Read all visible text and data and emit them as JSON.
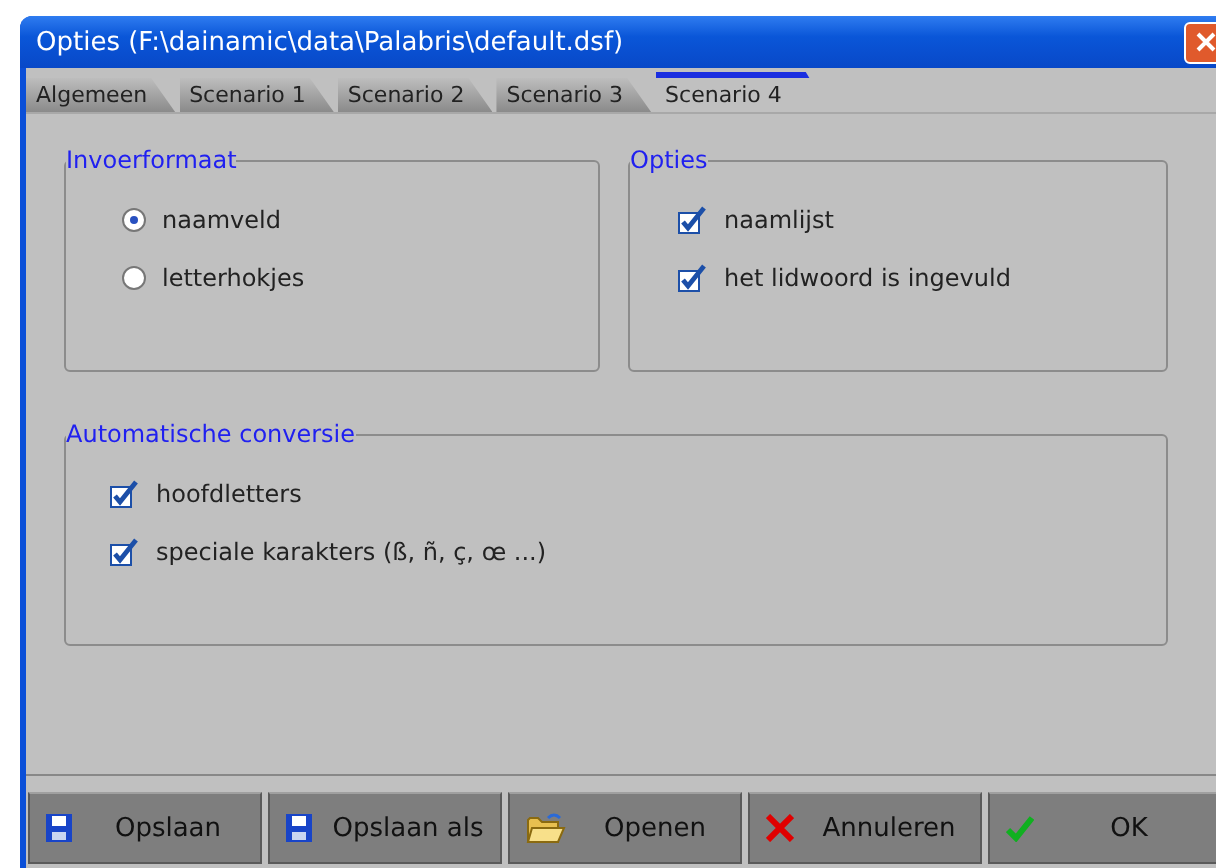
{
  "window": {
    "title": "Opties (F:\\dainamic\\data\\Palabris\\default.dsf)"
  },
  "tabs": [
    {
      "label": "Algemeen",
      "selected": false
    },
    {
      "label": "Scenario 1",
      "selected": false
    },
    {
      "label": "Scenario 2",
      "selected": false
    },
    {
      "label": "Scenario 3",
      "selected": false
    },
    {
      "label": "Scenario 4",
      "selected": true
    }
  ],
  "groups": [
    {
      "title": "Invoerformaat",
      "items": [
        {
          "kind": "radio",
          "label": "naamveld",
          "selected": true
        },
        {
          "kind": "radio",
          "label": "letterhokjes",
          "selected": false
        }
      ]
    },
    {
      "title": "Opties",
      "items": [
        {
          "kind": "checkbox",
          "label": "naamlijst",
          "checked": true
        },
        {
          "kind": "checkbox",
          "label": "het lidwoord is ingevuld",
          "checked": true
        }
      ]
    },
    {
      "title": "Automatische conversie",
      "items": [
        {
          "kind": "checkbox",
          "label": "hoofdletters",
          "checked": true
        },
        {
          "kind": "checkbox",
          "label": "speciale karakters (ß, ñ, ç, œ ...)",
          "checked": true
        }
      ]
    }
  ],
  "buttons": [
    {
      "label": "Opslaan",
      "kind": "save"
    },
    {
      "label": "Opslaan als",
      "kind": "save"
    },
    {
      "label": "Openen",
      "kind": "open"
    },
    {
      "label": "Annuleren",
      "kind": "cancel"
    },
    {
      "label": "OK",
      "kind": "ok"
    }
  ]
}
